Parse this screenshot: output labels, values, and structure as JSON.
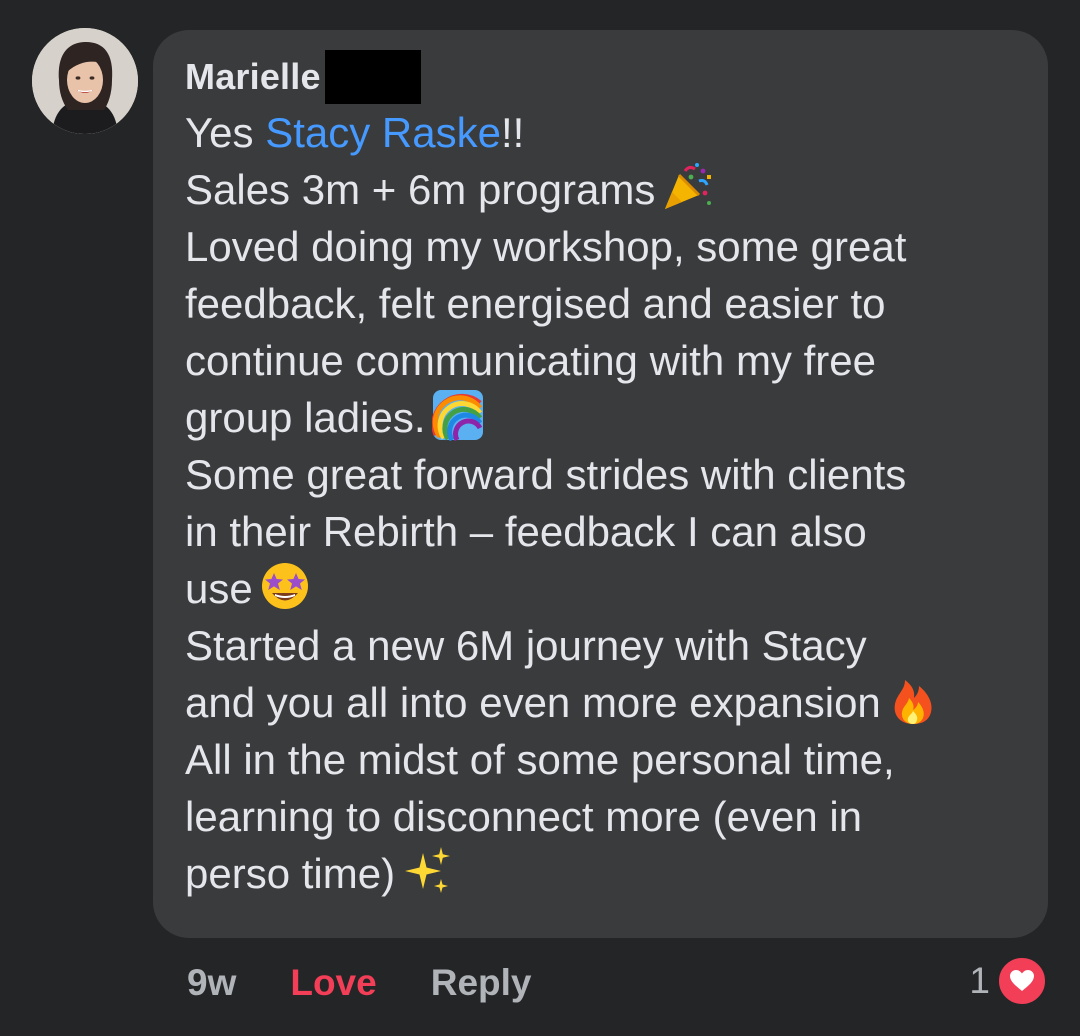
{
  "comment": {
    "author": "Marielle",
    "mention": "Stacy Raske",
    "lines": [
      {
        "before": "Yes ",
        "mention": true,
        "after": "!!"
      },
      {
        "text": "Sales 3m + 6m programs",
        "emoji": "party-popper-icon"
      },
      {
        "text": "Loved doing my  workshop, some great"
      },
      {
        "text": "feedback, felt energised and easier to"
      },
      {
        "text": "continue communicating with my free"
      },
      {
        "text": "group ladies.",
        "emoji": "rainbow-icon"
      },
      {
        "text": "Some great forward strides with clients"
      },
      {
        "text": "in their Rebirth – feedback I can also"
      },
      {
        "text": "use",
        "emoji": "star-struck-icon"
      },
      {
        "text": "Started a new 6M journey with Stacy"
      },
      {
        "text": "and you all into even more expansion",
        "emoji": "fire-icon"
      },
      {
        "text": "All in the midst of some personal time,"
      },
      {
        "text": "learning to disconnect more (even in"
      },
      {
        "text": "perso time)",
        "emoji": "sparkles-icon"
      }
    ]
  },
  "actions": {
    "time": "9w",
    "love": "Love",
    "reply": "Reply"
  },
  "reactions": {
    "count": "1",
    "icon": "heart-icon"
  },
  "colors": {
    "background": "#242526",
    "bubble": "#3a3b3c",
    "text": "#e4e6eb",
    "mention": "#4599ff",
    "love": "#f33e58",
    "muted": "#b0b3b8"
  }
}
